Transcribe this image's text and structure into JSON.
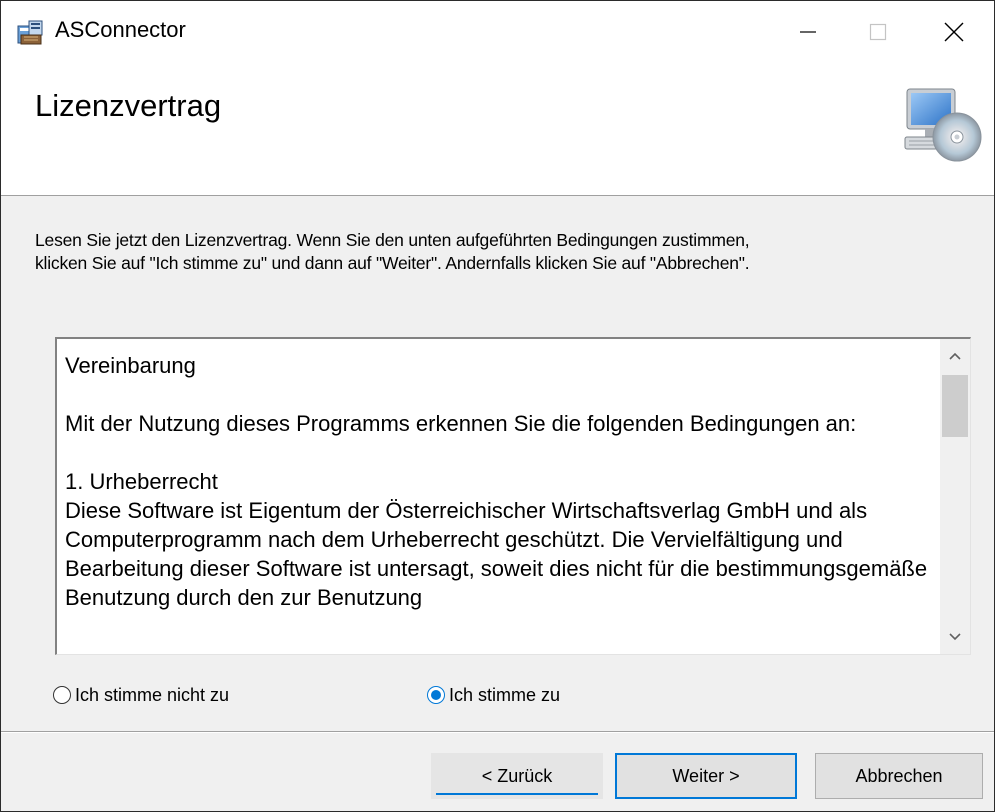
{
  "window": {
    "title": "ASConnector",
    "controls": {
      "minimize_icon": "minimize-icon",
      "maximize_icon": "maximize-icon",
      "close_icon": "close-icon"
    }
  },
  "header": {
    "title": "Lizenzvertrag",
    "icon": "computer-cd-icon"
  },
  "instruction": {
    "line1": "Lesen Sie jetzt den Lizenzvertrag. Wenn Sie den unten aufgeführten Bedingungen zustimmen,",
    "line2": "klicken Sie auf  \"Ich stimme zu\" und dann auf \"Weiter\". Andernfalls klicken Sie auf \"Abbrechen\"."
  },
  "license": {
    "heading": "Vereinbarung",
    "intro": "Mit der Nutzung dieses Programms erkennen Sie die folgenden Bedingungen an:",
    "section1_title": "1. Urheberrecht",
    "section1_text": "Diese Software ist Eigentum der Österreichischer Wirtschaftsverlag GmbH und als Computerprogramm nach dem Urheberrecht geschützt. Die Vervielfältigung und Bearbeitung dieser Software ist untersagt, soweit dies nicht für die bestimmungsgemäße Benutzung durch den zur Benutzung"
  },
  "options": {
    "disagree_label": "Ich stimme nicht zu",
    "agree_label": "Ich stimme zu",
    "selected": "agree"
  },
  "buttons": {
    "back_label": "< Zurück",
    "next_label": "Weiter >",
    "cancel_label": "Abbrechen"
  },
  "colors": {
    "accent": "#0078d7",
    "window_bg": "#f0f0f0",
    "header_bg": "#ffffff"
  }
}
